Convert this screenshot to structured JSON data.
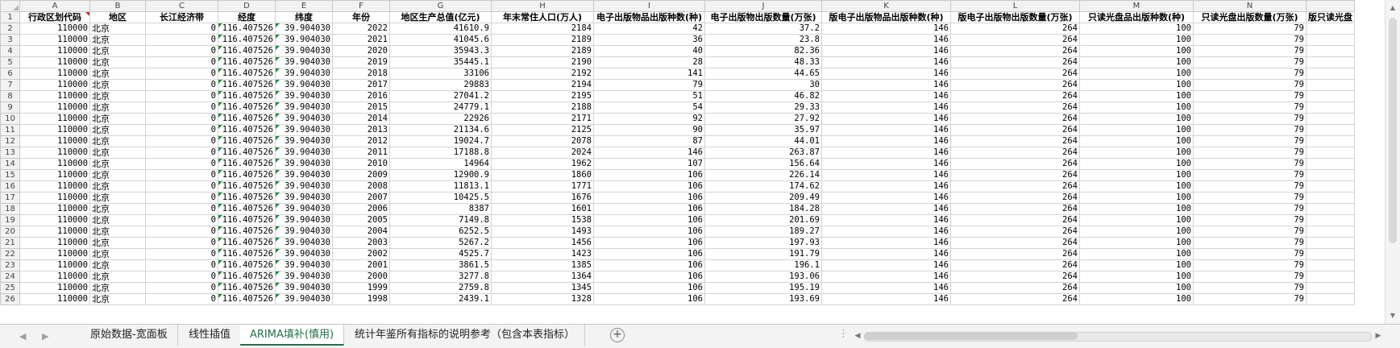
{
  "sheet": {
    "column_letters": [
      "A",
      "B",
      "C",
      "D",
      "E",
      "F",
      "G",
      "H",
      "I",
      "J",
      "K",
      "L",
      "M",
      "N"
    ],
    "headers": [
      "行政区划代码",
      "地区",
      "长江经济带",
      "经度",
      "纬度",
      "年份",
      "地区生产总值(亿元)",
      "年末常住人口(万人)",
      "电子出版物品出版种数(种)",
      "电子出版物出版数量(万张)",
      "版电子出版物品出版种数(种)",
      "版电子出版物出版数量(万张)",
      "只读光盘品出版种数(种)",
      "只读光盘出版数量(万张)"
    ],
    "extra_header": "版只读光盘",
    "rows": [
      {
        "n": "2",
        "c": [
          "110000",
          "北京",
          "0",
          "116.407526",
          "39.904030",
          "2022",
          "41610.9",
          "2184",
          "42",
          "37.2",
          "146",
          "264",
          "100",
          "79"
        ]
      },
      {
        "n": "3",
        "c": [
          "110000",
          "北京",
          "0",
          "116.407526",
          "39.904030",
          "2021",
          "41045.6",
          "2189",
          "36",
          "23.8",
          "146",
          "264",
          "100",
          "79"
        ]
      },
      {
        "n": "4",
        "c": [
          "110000",
          "北京",
          "0",
          "116.407526",
          "39.904030",
          "2020",
          "35943.3",
          "2189",
          "40",
          "82.36",
          "146",
          "264",
          "100",
          "79"
        ]
      },
      {
        "n": "5",
        "c": [
          "110000",
          "北京",
          "0",
          "116.407526",
          "39.904030",
          "2019",
          "35445.1",
          "2190",
          "28",
          "48.33",
          "146",
          "264",
          "100",
          "79"
        ]
      },
      {
        "n": "6",
        "c": [
          "110000",
          "北京",
          "0",
          "116.407526",
          "39.904030",
          "2018",
          "33106",
          "2192",
          "141",
          "44.65",
          "146",
          "264",
          "100",
          "79"
        ]
      },
      {
        "n": "7",
        "c": [
          "110000",
          "北京",
          "0",
          "116.407526",
          "39.904030",
          "2017",
          "29883",
          "2194",
          "79",
          "30",
          "146",
          "264",
          "100",
          "79"
        ]
      },
      {
        "n": "8",
        "c": [
          "110000",
          "北京",
          "0",
          "116.407526",
          "39.904030",
          "2016",
          "27041.2",
          "2195",
          "51",
          "46.82",
          "146",
          "264",
          "100",
          "79"
        ]
      },
      {
        "n": "9",
        "c": [
          "110000",
          "北京",
          "0",
          "116.407526",
          "39.904030",
          "2015",
          "24779.1",
          "2188",
          "54",
          "29.33",
          "146",
          "264",
          "100",
          "79"
        ]
      },
      {
        "n": "10",
        "c": [
          "110000",
          "北京",
          "0",
          "116.407526",
          "39.904030",
          "2014",
          "22926",
          "2171",
          "92",
          "27.92",
          "146",
          "264",
          "100",
          "79"
        ]
      },
      {
        "n": "11",
        "c": [
          "110000",
          "北京",
          "0",
          "116.407526",
          "39.904030",
          "2013",
          "21134.6",
          "2125",
          "90",
          "35.97",
          "146",
          "264",
          "100",
          "79"
        ]
      },
      {
        "n": "12",
        "c": [
          "110000",
          "北京",
          "0",
          "116.407526",
          "39.904030",
          "2012",
          "19024.7",
          "2078",
          "87",
          "44.01",
          "146",
          "264",
          "100",
          "79"
        ]
      },
      {
        "n": "13",
        "c": [
          "110000",
          "北京",
          "0",
          "116.407526",
          "39.904030",
          "2011",
          "17188.8",
          "2024",
          "146",
          "263.87",
          "146",
          "264",
          "100",
          "79"
        ]
      },
      {
        "n": "14",
        "c": [
          "110000",
          "北京",
          "0",
          "116.407526",
          "39.904030",
          "2010",
          "14964",
          "1962",
          "107",
          "156.64",
          "146",
          "264",
          "100",
          "79"
        ]
      },
      {
        "n": "15",
        "c": [
          "110000",
          "北京",
          "0",
          "116.407526",
          "39.904030",
          "2009",
          "12900.9",
          "1860",
          "106",
          "226.14",
          "146",
          "264",
          "100",
          "79"
        ]
      },
      {
        "n": "16",
        "c": [
          "110000",
          "北京",
          "0",
          "116.407526",
          "39.904030",
          "2008",
          "11813.1",
          "1771",
          "106",
          "174.62",
          "146",
          "264",
          "100",
          "79"
        ]
      },
      {
        "n": "17",
        "c": [
          "110000",
          "北京",
          "0",
          "116.407526",
          "39.904030",
          "2007",
          "10425.5",
          "1676",
          "106",
          "209.49",
          "146",
          "264",
          "100",
          "79"
        ]
      },
      {
        "n": "18",
        "c": [
          "110000",
          "北京",
          "0",
          "116.407526",
          "39.904030",
          "2006",
          "8387",
          "1601",
          "106",
          "184.28",
          "146",
          "264",
          "100",
          "79"
        ]
      },
      {
        "n": "19",
        "c": [
          "110000",
          "北京",
          "0",
          "116.407526",
          "39.904030",
          "2005",
          "7149.8",
          "1538",
          "106",
          "201.69",
          "146",
          "264",
          "100",
          "79"
        ]
      },
      {
        "n": "20",
        "c": [
          "110000",
          "北京",
          "0",
          "116.407526",
          "39.904030",
          "2004",
          "6252.5",
          "1493",
          "106",
          "189.27",
          "146",
          "264",
          "100",
          "79"
        ]
      },
      {
        "n": "21",
        "c": [
          "110000",
          "北京",
          "0",
          "116.407526",
          "39.904030",
          "2003",
          "5267.2",
          "1456",
          "106",
          "197.93",
          "146",
          "264",
          "100",
          "79"
        ]
      },
      {
        "n": "22",
        "c": [
          "110000",
          "北京",
          "0",
          "116.407526",
          "39.904030",
          "2002",
          "4525.7",
          "1423",
          "106",
          "191.79",
          "146",
          "264",
          "100",
          "79"
        ]
      },
      {
        "n": "23",
        "c": [
          "110000",
          "北京",
          "0",
          "116.407526",
          "39.904030",
          "2001",
          "3861.5",
          "1385",
          "106",
          "196.1",
          "146",
          "264",
          "100",
          "79"
        ]
      },
      {
        "n": "24",
        "c": [
          "110000",
          "北京",
          "0",
          "116.407526",
          "39.904030",
          "2000",
          "3277.8",
          "1364",
          "106",
          "193.06",
          "146",
          "264",
          "100",
          "79"
        ]
      },
      {
        "n": "25",
        "c": [
          "110000",
          "北京",
          "0",
          "116.407526",
          "39.904030",
          "1999",
          "2759.8",
          "1345",
          "106",
          "195.19",
          "146",
          "264",
          "100",
          "79"
        ]
      },
      {
        "n": "26",
        "c": [
          "110000",
          "北京",
          "0",
          "116.407526",
          "39.904030",
          "1998",
          "2439.1",
          "1328",
          "106",
          "193.69",
          "146",
          "264",
          "100",
          "79"
        ]
      }
    ]
  },
  "tabs": [
    "原始数据-宽面板",
    "线性插值",
    "ARIMA填补(慎用)",
    "统计年鉴所有指标的说明参考（包含本表指标）"
  ],
  "active_tab_index": 2,
  "tab_nav": {
    "prev": "◀",
    "next": "▶"
  },
  "add_sheet_label": "+",
  "overflow_dots": "⋮",
  "scroll_arrows": {
    "up": "▲",
    "down": "▼",
    "left": "◀",
    "right": "▶"
  },
  "colors": {
    "accent": "#217346",
    "green_triangle": "#1e8c3e",
    "red_triangle": "#dd2222"
  }
}
